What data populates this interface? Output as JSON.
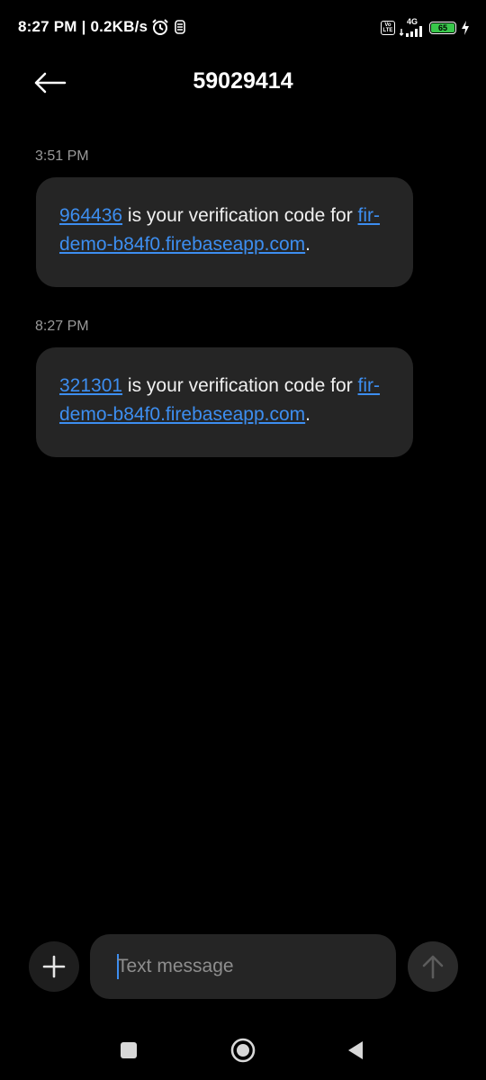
{
  "status_bar": {
    "time_speed": "8:27 PM | 0.2KB/s",
    "volte": "Vo LTE",
    "network": "4G",
    "battery": "65"
  },
  "header": {
    "title": "59029414"
  },
  "messages": [
    {
      "timestamp": "3:51 PM",
      "code": "964436",
      "text": " is your verification code for ",
      "link": "fir-demo-b84f0.firebaseapp.com",
      "end": "."
    },
    {
      "timestamp": "8:27 PM",
      "code": "321301",
      "text": " is your verification code for ",
      "link": "fir-demo-b84f0.firebaseapp.com",
      "end": "."
    }
  ],
  "composer": {
    "placeholder": "Text message"
  },
  "icons": {
    "back": "arrow-left-icon",
    "add": "plus-icon",
    "send": "arrow-up-icon",
    "recents": "square-icon",
    "home": "circle-icon",
    "back_nav": "triangle-left-icon"
  },
  "colors": {
    "link": "#3d8ef0",
    "bubble": "#252525",
    "battery": "#39c74b"
  }
}
